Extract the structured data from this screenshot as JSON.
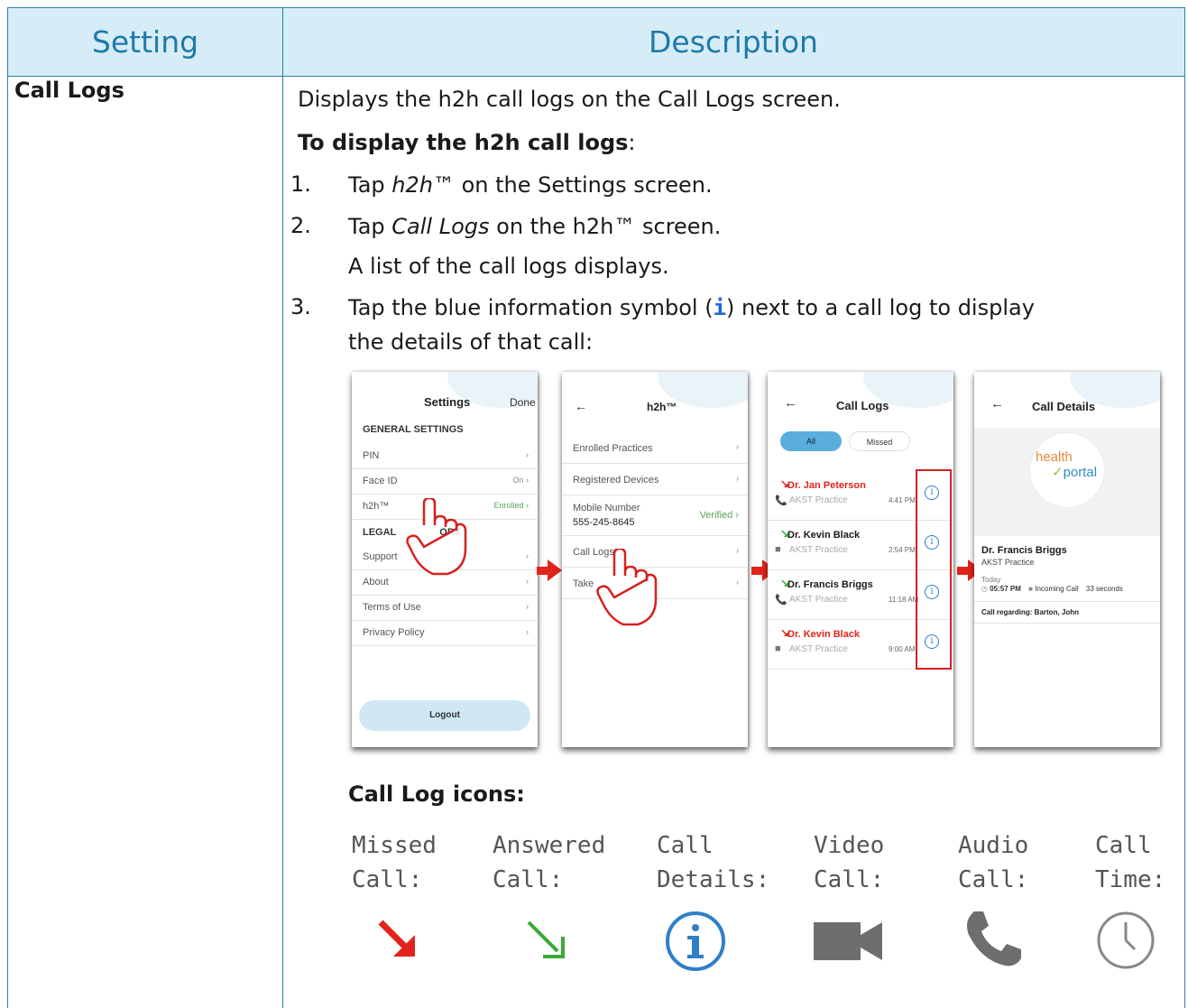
{
  "header": {
    "col1": "Setting",
    "col2": "Description"
  },
  "row": {
    "setting": "Call Logs",
    "intro": "Displays the h2h call logs on the Call Logs screen.",
    "subhead": "To display the h2h call logs",
    "subhead_suffix": ":",
    "steps": [
      {
        "num": "1.",
        "pre": "Tap ",
        "em": "h2h",
        "post": "™ on the Settings screen."
      },
      {
        "num": "2.",
        "pre": "Tap ",
        "em": "Call Logs",
        "post": " on the h2h™ screen.",
        "extra": "A list of the call logs displays."
      },
      {
        "num": "3.",
        "pre": "Tap the blue information symbol (",
        "sym": "i",
        "post": ") next to a call log to display",
        "line2": "the details of that call:"
      }
    ]
  },
  "screens": {
    "settings": {
      "title": "Settings",
      "done": "Done",
      "section1": "GENERAL SETTINGS",
      "items1": [
        {
          "label": "PIN",
          "value": ""
        },
        {
          "label": "Face ID",
          "value": "On"
        },
        {
          "label": "h2h™",
          "value": "Enrolled"
        }
      ],
      "section2_a": "LEGAL",
      "section2_b": "ORT",
      "items2": [
        "Support",
        "About",
        "Terms of Use",
        "Privacy Policy"
      ],
      "logout": "Logout"
    },
    "h2h": {
      "title": "h2h™",
      "items": [
        "Enrolled Practices",
        "Registered Devices"
      ],
      "mobile_label": "Mobile Number",
      "mobile_value": "555-245-8645",
      "verified": "Verified",
      "call_logs": "Call Logs",
      "take": "Take"
    },
    "call_logs": {
      "title": "Call Logs",
      "tab_all": "All",
      "tab_missed": "Missed",
      "entries": [
        {
          "name": "Dr. Jan Peterson",
          "practice": "AKST Practice",
          "time": "4:41 PM",
          "type": "missed"
        },
        {
          "name": "Dr. Kevin Black",
          "practice": "AKST Practice",
          "time": "2:54 PM",
          "type": "answered"
        },
        {
          "name": "Dr. Francis Briggs",
          "practice": "AKST Practice",
          "time": "11:18 AM",
          "type": "answered"
        },
        {
          "name": "Dr. Kevin Black",
          "practice": "AKST Practice",
          "time": "9:00 AM",
          "type": "missed"
        }
      ]
    },
    "call_details": {
      "title": "Call Details",
      "logo_top": "health",
      "logo_bottom": "portal",
      "name": "Dr. Francis Briggs",
      "practice": "AKST Practice",
      "day": "Today",
      "time": "05:57 PM",
      "call_type": "Incoming Call",
      "duration": "33 seconds",
      "regarding": "Call regarding: Barton, John"
    }
  },
  "legend": {
    "title": "Call Log icons:",
    "items": [
      {
        "line1": "Missed",
        "line2": "Call:",
        "icon": "missed-call-arrow"
      },
      {
        "line1": "Answered",
        "line2": "Call:",
        "icon": "answered-call-arrow"
      },
      {
        "line1": "Call",
        "line2": "Details:",
        "icon": "info-icon"
      },
      {
        "line1": "Video",
        "line2": "Call:",
        "icon": "video-camera-icon"
      },
      {
        "line1": "Audio",
        "line2": "Call:",
        "icon": "phone-handset-icon"
      },
      {
        "line1": "Call",
        "line2": "Time:",
        "icon": "clock-icon"
      }
    ]
  },
  "colors": {
    "header_bg": "#d6ecf6",
    "header_text": "#1e7aa8",
    "border": "#2e7fa3",
    "missed": "#e2231a",
    "answered": "#3aaa35",
    "info": "#2e7fc8"
  }
}
